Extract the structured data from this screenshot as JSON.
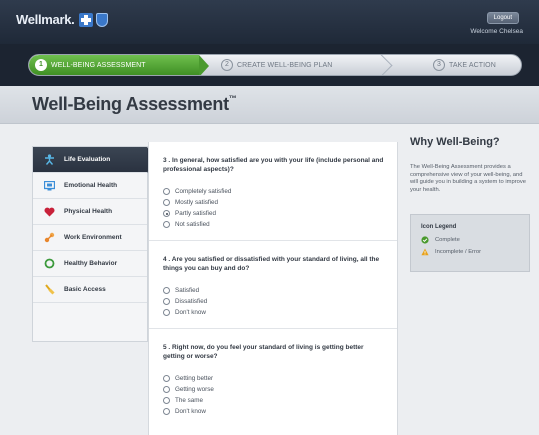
{
  "header": {
    "logo_text": "Wellmark.",
    "logout_label": "Logout",
    "welcome_text": "Welcome Chelsea"
  },
  "steps": [
    {
      "number": "1",
      "label": "Well-Being Assessment",
      "state": "active"
    },
    {
      "number": "2",
      "label": "Create Well-Being Plan",
      "state": "inactive"
    },
    {
      "number": "3",
      "label": "Take Action",
      "state": "inactive"
    }
  ],
  "page": {
    "title": "Well-Being Assessment",
    "trademark": "™"
  },
  "sidebar": {
    "items": [
      {
        "label": "Life Evaluation",
        "icon": "person-figure-icon",
        "icon_color": "#58b7e6",
        "active": true
      },
      {
        "label": "Emotional Health",
        "icon": "screen-icon",
        "icon_color": "#3b8ed8",
        "active": false
      },
      {
        "label": "Physical Health",
        "icon": "heart-icon",
        "icon_color": "#c8213a",
        "active": false
      },
      {
        "label": "Work Environment",
        "icon": "bolt-icon",
        "icon_color": "#e8862c",
        "active": false
      },
      {
        "label": "Healthy Behavior",
        "icon": "ring-icon",
        "icon_color": "#3c9a3c",
        "active": false
      },
      {
        "label": "Basic Access",
        "icon": "brush-icon",
        "icon_color": "#e0a81c",
        "active": false
      }
    ]
  },
  "questions": [
    {
      "text": "3 .  In general, how satisfied are you with your life (include personal and professional aspects)?",
      "options": [
        {
          "label": "Completely satisfied",
          "checked": false
        },
        {
          "label": "Mostly satisfied",
          "checked": false
        },
        {
          "label": "Partly satisfied",
          "checked": true
        },
        {
          "label": "Not satisfied",
          "checked": false
        }
      ]
    },
    {
      "text": "4 .  Are you satisfied or dissatisfied with your standard of living, all the things you can buy and do?",
      "options": [
        {
          "label": "Satisfied",
          "checked": false
        },
        {
          "label": "Dissatisfied",
          "checked": false
        },
        {
          "label": "Don't know",
          "checked": false
        }
      ]
    },
    {
      "text": "5 .  Right now, do you feel your standard of living is getting better getting or worse?",
      "options": [
        {
          "label": "Getting better",
          "checked": false
        },
        {
          "label": "Getting worse",
          "checked": false
        },
        {
          "label": "The same",
          "checked": false
        },
        {
          "label": "Don't know",
          "checked": false
        }
      ]
    }
  ],
  "why": {
    "title": "Why Well-Being?",
    "text": "The Well-Being Assessment provides a comprehensive view of your well-being, and will guide you in building a system to improve your health."
  },
  "legend": {
    "title": "Icon Legend",
    "items": [
      {
        "label": "Complete",
        "icon": "check-circle-icon",
        "color": "#4a9a2e"
      },
      {
        "label": "Incomplete / Error",
        "icon": "warning-triangle-icon",
        "color": "#e8a21c"
      }
    ]
  }
}
